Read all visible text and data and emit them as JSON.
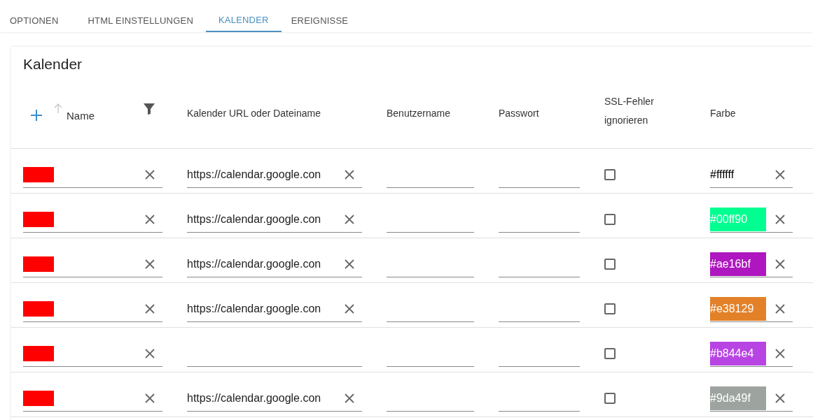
{
  "tabs": [
    {
      "label": "OPTIONEN",
      "selected": false
    },
    {
      "label": "HTML EINSTELLUNGEN",
      "selected": false
    },
    {
      "label": "KALENDER",
      "selected": true
    },
    {
      "label": "EREIGNISSE",
      "selected": false
    }
  ],
  "card": {
    "title": "Kalender",
    "columns": [
      "Name",
      "Kalender URL oder Dateiname",
      "Benutzername",
      "Passwort",
      "SSL-Fehler ignorieren",
      "Farbe"
    ],
    "rows": [
      {
        "redacted": true,
        "url": "https://calendar.google.con",
        "ssl_ignore": false,
        "color_text": "#ffffff",
        "color": "#ffffff"
      },
      {
        "redacted": true,
        "url": "https://calendar.google.con",
        "ssl_ignore": false,
        "color_text": "#00ff90",
        "color": "#00ff90"
      },
      {
        "redacted": true,
        "url": "https://calendar.google.con",
        "ssl_ignore": false,
        "color_text": "#ae16bf",
        "color": "#ae16bf"
      },
      {
        "redacted": true,
        "url": "https://calendar.google.con",
        "ssl_ignore": false,
        "color_text": "#e38129",
        "color": "#e38129"
      },
      {
        "redacted": true,
        "ssl_ignore": false,
        "color_text": "#b844e4",
        "color": "#b844e4"
      },
      {
        "redacted": true,
        "url": "https://calendar.google.con",
        "ssl_ignore": false,
        "color_text": "#9da49f",
        "color": "#9da49f"
      }
    ]
  }
}
